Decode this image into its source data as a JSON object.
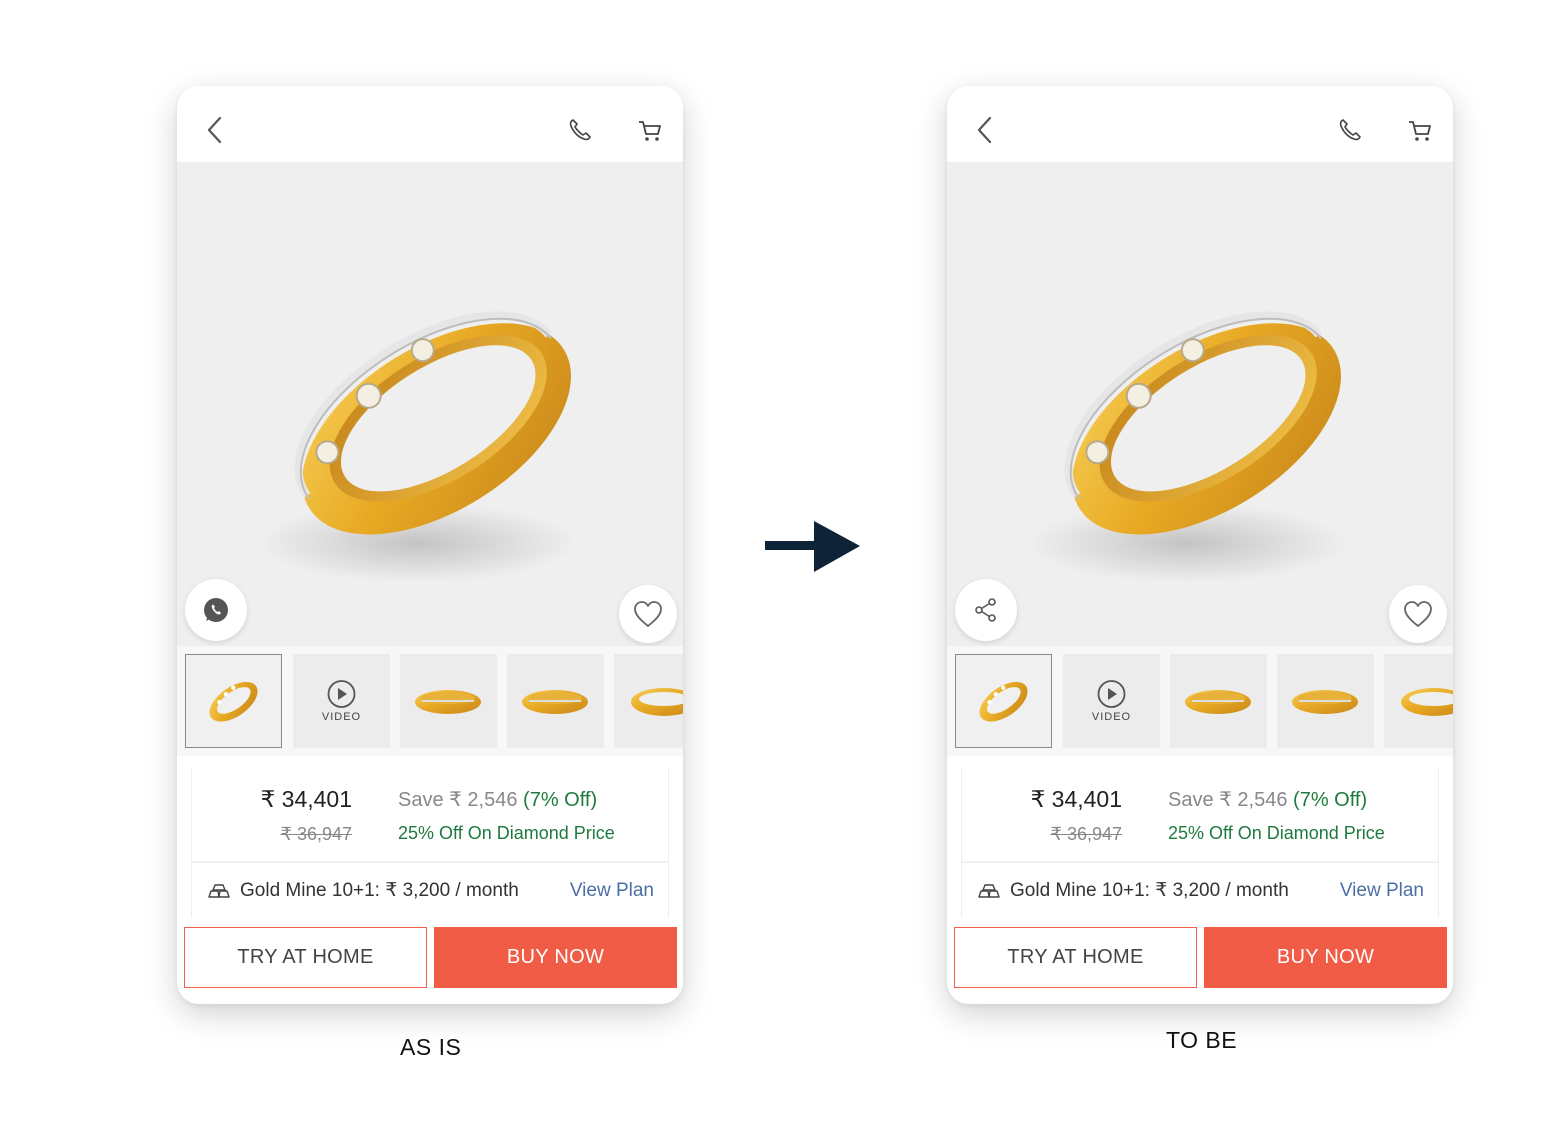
{
  "screens": [
    {
      "id": "as-is",
      "caption": "AS IS",
      "left_action_icon": "whatsapp-icon",
      "thumbnails": [
        {
          "type": "image",
          "active": true
        },
        {
          "type": "video",
          "label": "VIDEO"
        },
        {
          "type": "image"
        },
        {
          "type": "image"
        },
        {
          "type": "image"
        }
      ],
      "price": "₹ 34,401",
      "original_price": "₹ 36,947",
      "save_text": "Save ₹ 2,546",
      "off_text": "(7% Off)",
      "diamond_offer": "25% Off On Diamond Price",
      "gold_mine": "Gold Mine 10+1: ₹ 3,200 / month",
      "view_plan": "View Plan",
      "try_at_home": "TRY AT HOME",
      "buy_now": "BUY NOW"
    },
    {
      "id": "to-be",
      "caption": "TO BE",
      "left_action_icon": "share-icon",
      "thumbnails": [
        {
          "type": "image",
          "active": true
        },
        {
          "type": "video",
          "label": "VIDEO"
        },
        {
          "type": "image"
        },
        {
          "type": "image"
        },
        {
          "type": "image"
        }
      ],
      "price": "₹ 34,401",
      "original_price": "₹ 36,947",
      "save_text": "Save ₹ 2,546",
      "off_text": "(7% Off)",
      "diamond_offer": "25% Off On Diamond Price",
      "gold_mine": "Gold Mine 10+1: ₹ 3,200 / month",
      "view_plan": "View Plan",
      "try_at_home": "TRY AT HOME",
      "buy_now": "BUY NOW"
    }
  ],
  "colors": {
    "accent": "#f15c47",
    "offer_green": "#1e7a3e",
    "link_blue": "#4a6fa5",
    "arrow": "#0e2238",
    "gold": "#e8a923"
  },
  "transition_icon": "arrow-right-icon"
}
